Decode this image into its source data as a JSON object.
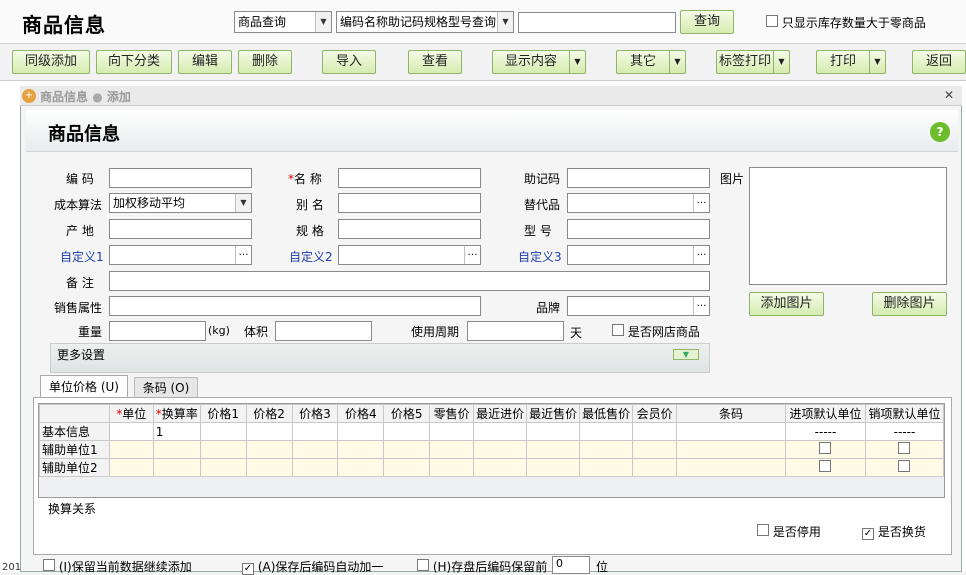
{
  "app": {
    "title": "商品信息"
  },
  "search": {
    "type": "商品查询",
    "field": "编码名称助记码规格型号查询",
    "value": "",
    "button": "查询",
    "filter_label": "只显示库存数量大于零商品"
  },
  "toolbar": {
    "same_level_add": "同级添加",
    "add_sub": "向下分类",
    "edit": "编辑",
    "delete": "删除",
    "import": "导入",
    "view": "查看",
    "display": "显示内容",
    "other": "其它",
    "label_print": "标签打印",
    "print": "打印",
    "back": "返回"
  },
  "dialog": {
    "title": "商品信息",
    "mode": "添加",
    "heading": "商品信息",
    "help_icon": "?",
    "fields": {
      "code": "编 码",
      "name": "名 称",
      "mnemonic": "助记码",
      "image": "图片",
      "cost_method": "成本算法",
      "cost_method_value": "加权移动平均",
      "alias": "别 名",
      "substitute": "替代品",
      "origin": "产 地",
      "spec": "规 格",
      "model": "型 号",
      "custom1": "自定义1",
      "custom2": "自定义2",
      "custom3": "自定义3",
      "remark": "备 注",
      "sales_attr": "销售属性",
      "brand": "品牌",
      "weight": "重量",
      "weight_unit": "(kg)",
      "volume": "体积",
      "period": "使用周期",
      "period_unit": "天",
      "online": "是否网店商品",
      "name_required": "*"
    },
    "add_image": "添加图片",
    "delete_image": "删除图片",
    "more_settings": "更多设置",
    "tabs": [
      "单位价格 (U)",
      "条码 (O)"
    ],
    "table": {
      "headers": [
        "",
        "*单位",
        "*换算率",
        "价格1",
        "价格2",
        "价格3",
        "价格4",
        "价格5",
        "零售价",
        "最近进价",
        "最近售价",
        "最低售价",
        "会员价",
        "条码",
        "进项默认单位",
        "销项默认单位"
      ],
      "rows": [
        [
          "基本信息",
          "",
          "1",
          "",
          "",
          "",
          "",
          "",
          "",
          "",
          "",
          "",
          "",
          "",
          "-----",
          "-----"
        ],
        [
          "辅助单位1",
          "",
          "",
          "",
          "",
          "",
          "",
          "",
          "",
          "",
          "",
          "",
          "",
          "",
          "",
          ""
        ],
        [
          "辅助单位2",
          "",
          "",
          "",
          "",
          "",
          "",
          "",
          "",
          "",
          "",
          "",
          "",
          "",
          "",
          ""
        ]
      ]
    },
    "conversion": "换算关系",
    "disabled": "是否停用",
    "exchange": "是否换货",
    "footer": {
      "keep_data": "(I)保留当前数据继续添加",
      "auto_inc": "(A)保存后编码自动加一",
      "keep_code": "(H)存盘后编码保留前",
      "keep_count": "0",
      "digit_unit": "位"
    }
  },
  "status": {
    "year": "201"
  }
}
